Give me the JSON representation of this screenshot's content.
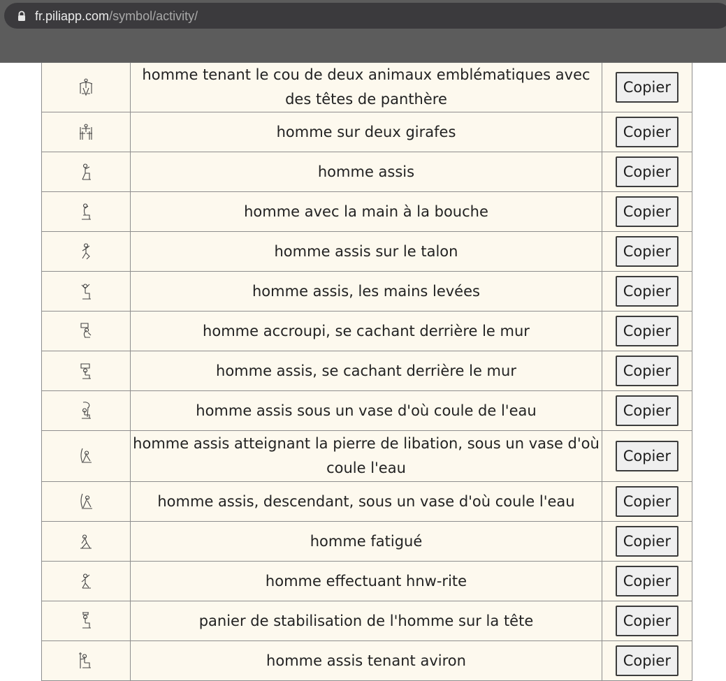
{
  "browser": {
    "url_host": "fr.piliapp.com",
    "url_path": "/symbol/activity/"
  },
  "rows": [
    {
      "glyph": "hieroglyph-man-holding-necks-of-two-panther-headed-animals-icon",
      "name": "homme tenant le cou de deux animaux emblématiques avec des têtes de panthère",
      "button": "Copier"
    },
    {
      "glyph": "hieroglyph-man-on-two-giraffes-icon",
      "name": "homme sur deux girafes",
      "button": "Copier"
    },
    {
      "glyph": "hieroglyph-seated-man-icon",
      "name": "homme assis",
      "button": "Copier"
    },
    {
      "glyph": "hieroglyph-man-hand-to-mouth-icon",
      "name": "homme avec la main à la bouche",
      "button": "Copier"
    },
    {
      "glyph": "hieroglyph-man-seated-on-heel-icon",
      "name": "homme assis sur le talon",
      "button": "Copier"
    },
    {
      "glyph": "hieroglyph-seated-man-hands-raised-icon",
      "name": "homme assis, les mains levées",
      "button": "Copier"
    },
    {
      "glyph": "hieroglyph-crouching-man-behind-wall-icon",
      "name": "homme accroupi, se cachant derrière le mur",
      "button": "Copier"
    },
    {
      "glyph": "hieroglyph-seated-man-behind-wall-icon",
      "name": "homme assis, se cachant derrière le mur",
      "button": "Copier"
    },
    {
      "glyph": "hieroglyph-seated-man-under-water-vase-icon",
      "name": "homme assis sous un vase d'où coule de l'eau",
      "button": "Copier"
    },
    {
      "glyph": "hieroglyph-seated-man-libation-stone-icon",
      "name": "homme assis atteignant la pierre de libation, sous un vase d'où coule l'eau",
      "button": "Copier"
    },
    {
      "glyph": "hieroglyph-seated-man-descending-under-vase-icon",
      "name": "homme assis, descendant, sous un vase d'où coule l'eau",
      "button": "Copier"
    },
    {
      "glyph": "hieroglyph-tired-man-icon",
      "name": "homme fatigué",
      "button": "Copier"
    },
    {
      "glyph": "hieroglyph-man-performing-hnw-rite-icon",
      "name": "homme effectuant hnw-rite",
      "button": "Copier"
    },
    {
      "glyph": "hieroglyph-man-basket-on-head-icon",
      "name": "panier de stabilisation de l'homme sur la tête",
      "button": "Copier"
    },
    {
      "glyph": "hieroglyph-seated-man-holding-oar-icon",
      "name": "homme assis tenant aviron",
      "button": "Copier"
    },
    {
      "glyph": "hieroglyph-partial-row-icon",
      "name": "",
      "button": ""
    }
  ]
}
